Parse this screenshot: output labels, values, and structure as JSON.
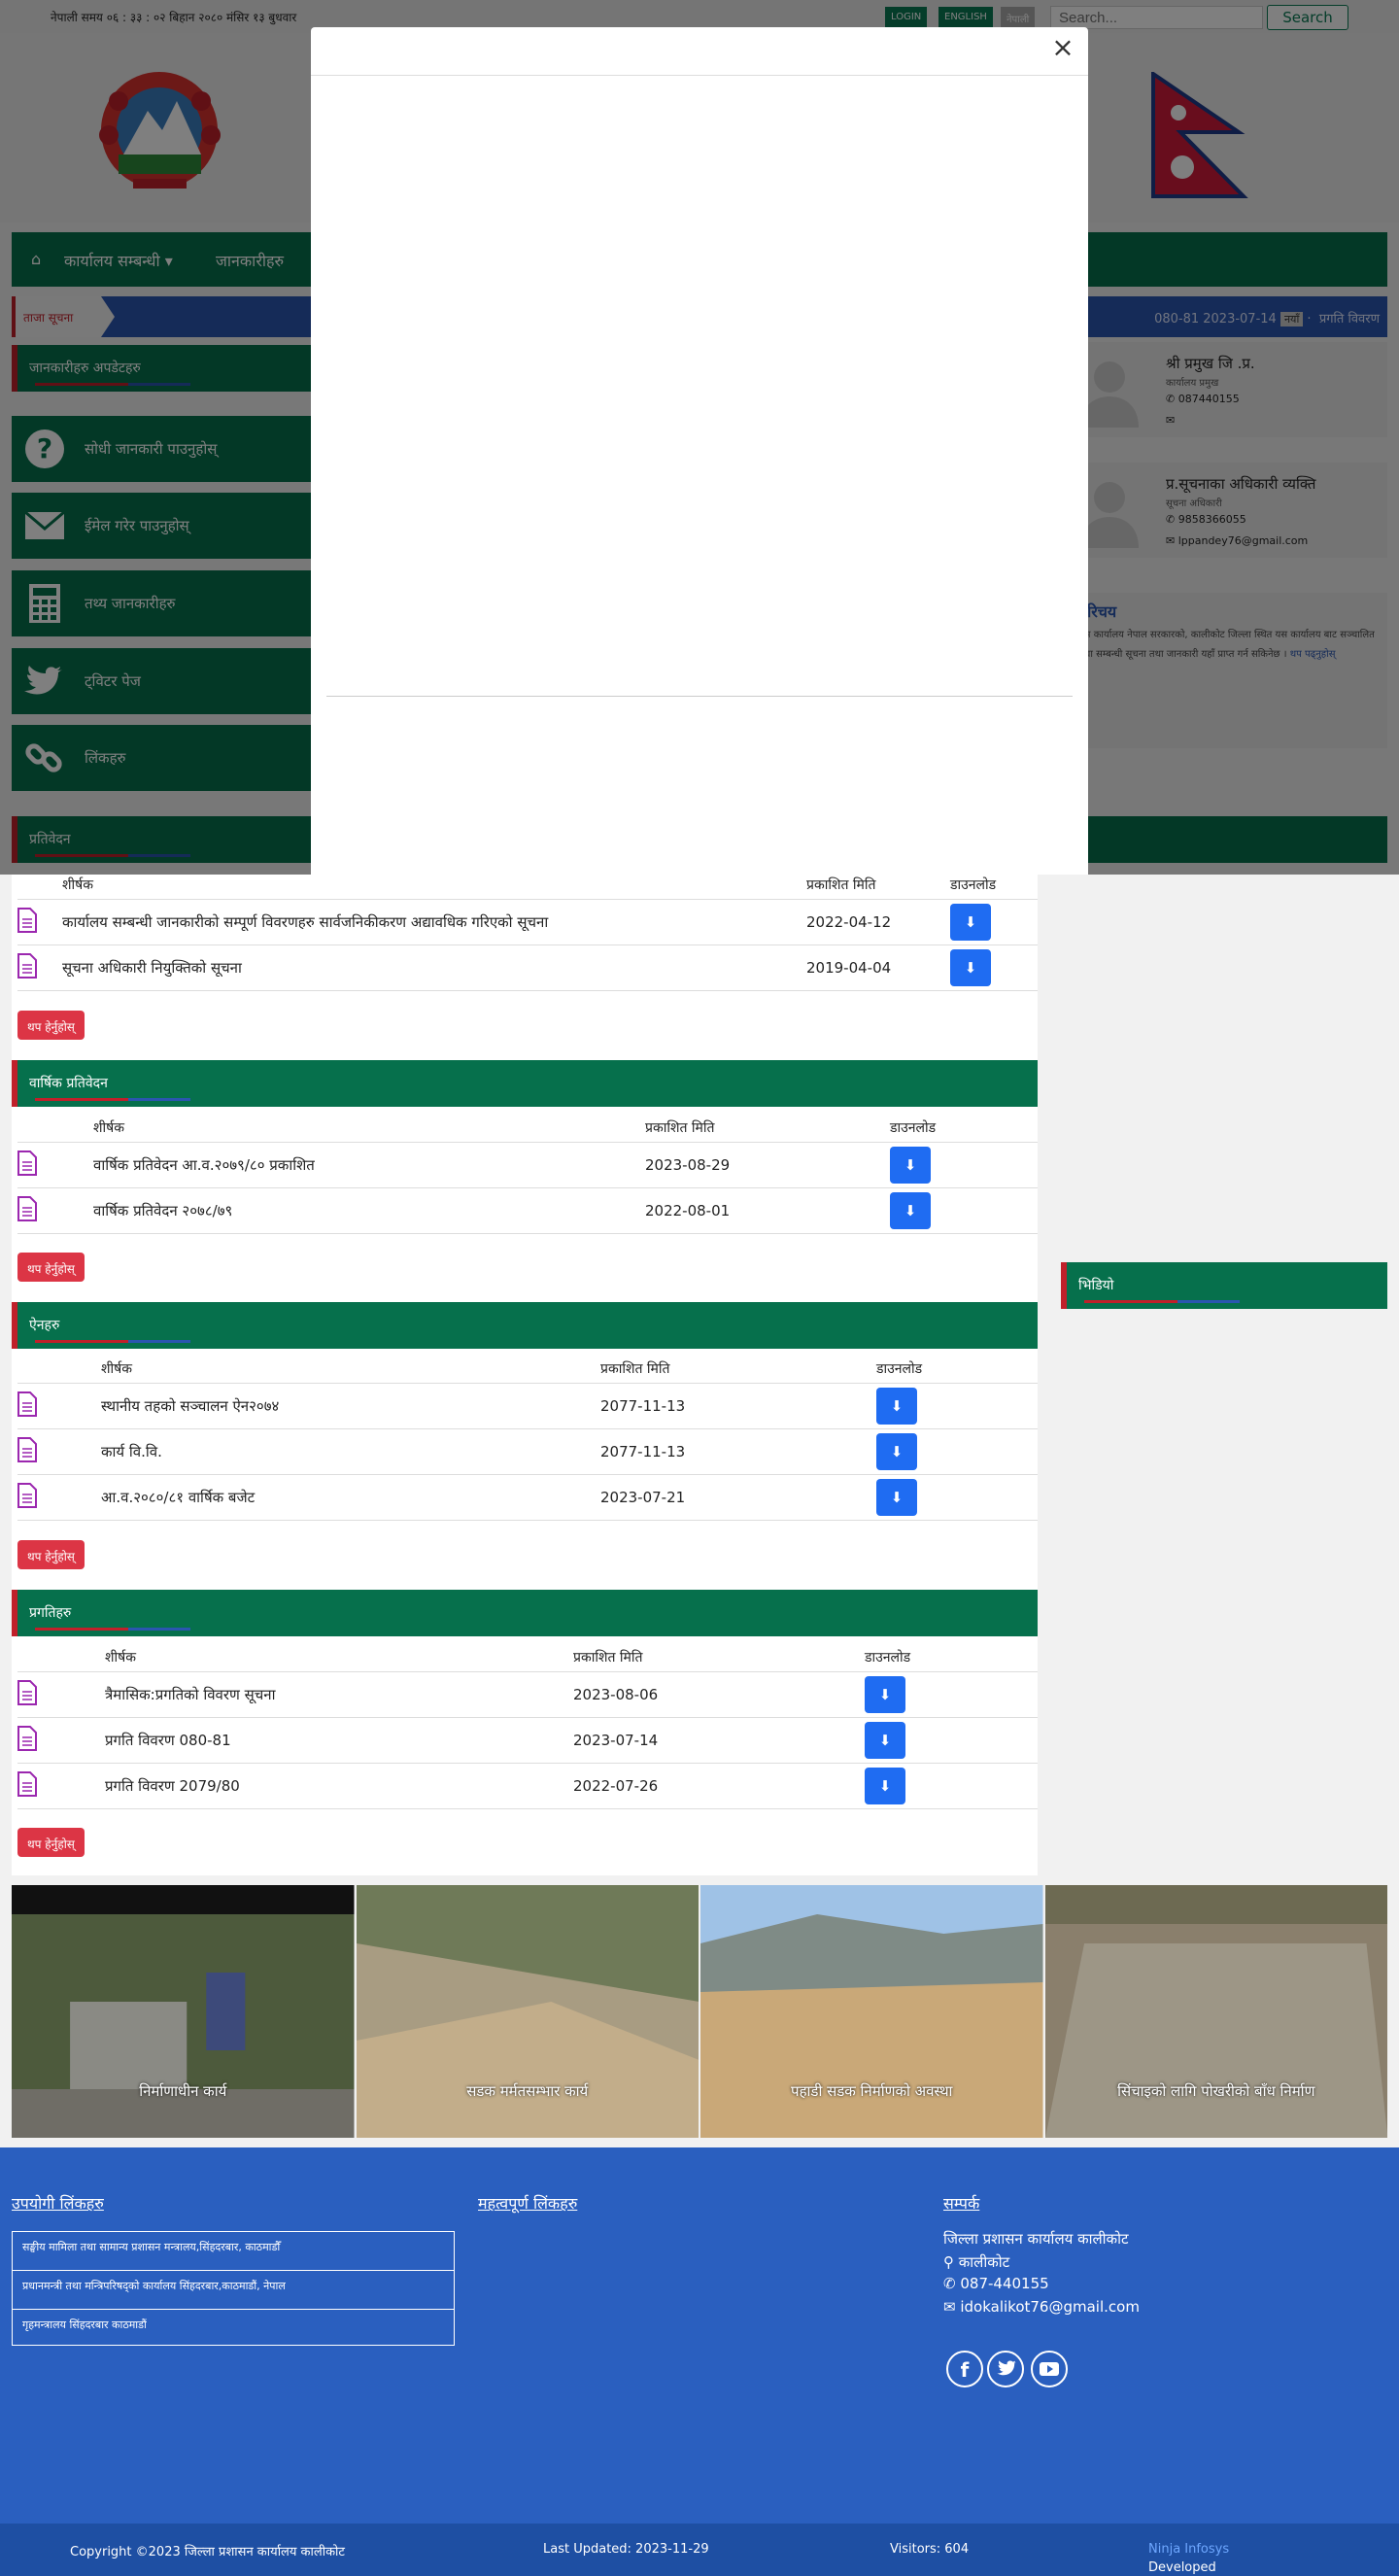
{
  "topbar": {
    "time": "नेपाली समय ०६ : ३३ : ०२ बिहान   २०८० मंसिर १३ बुधवार",
    "login": "LOGIN",
    "english": "ENGLISH",
    "nepali": "नेपाली",
    "search_placeholder": "Search...",
    "search_button": "Search"
  },
  "nav": {
    "home_icon": "home-icon",
    "items": [
      "कार्यालय सम्बन्धी",
      "जानकारीहरु"
    ]
  },
  "ticker": {
    "label": "ताजा सूचना",
    "news": "080-81 2023-07-14",
    "tag": "नयाँ",
    "news2": "प्रगति विवरण"
  },
  "left": {
    "notice_head": "जानकारीहरु अपडेटहरु",
    "buttons": [
      {
        "label": "सोधी जानकारी पाउनुहोस्",
        "icon": "question-icon"
      },
      {
        "label": "ईमेल गरेर पाउनुहोस्",
        "icon": "envelope-icon"
      },
      {
        "label": "तथ्य जानकारीहरु",
        "icon": "calculator-icon"
      },
      {
        "label": "ट्विटर पेज",
        "icon": "twitter-icon"
      },
      {
        "label": "लिंकहरु",
        "icon": "link-icon"
      }
    ],
    "bottom_head": "प्रतिवेदन"
  },
  "officials": [
    {
      "name": "श्री प्रमुख जि .प्र.",
      "role": "कार्यालय प्रमुख",
      "phone": "087440155",
      "email": ""
    },
    {
      "name": "प्र.सूचनाका अधिकारी व्यक्ति",
      "role": "सूचना अधिकारी",
      "phone": "9858366055",
      "email": "lppandey76@gmail.com"
    }
  ],
  "about": {
    "title": "परिचय",
    "text": "यस कार्यालय नेपाल सरकारको, कालीकोट जिल्ला स्थित यस कार्यालय बाट सञ्चालित सेवा सम्बन्धी सूचना तथा जानकारी यहाँ प्राप्त गर्न सकिनेछ ।",
    "more": "थप पढ्नुहोस्"
  },
  "right_head": "भिडियो",
  "sections": [
    {
      "title": "",
      "columns": [
        "शीर्षक",
        "प्रकाशित मिति",
        "डाउनलोड"
      ],
      "rows": [
        {
          "title": "कार्यालय सम्बन्धी जानकारीको सम्पूर्ण विवरणहरु सार्वजनिकीकरण अद्यावधिक गरिएको सूचना",
          "date": "2022-04-12"
        },
        {
          "title": "सूचना अधिकारी नियुक्तिको सूचना",
          "date": "2019-04-04"
        }
      ],
      "more": "थप हेर्नुहोस्"
    },
    {
      "title": "वार्षिक प्रतिवेदन",
      "columns": [
        "शीर्षक",
        "प्रकाशित मिति",
        "डाउनलोड"
      ],
      "rows": [
        {
          "title": "वार्षिक प्रतिवेदन आ.व.२०७९/८० प्रकाशित",
          "date": "2023-08-29"
        },
        {
          "title": "वार्षिक प्रतिवेदन २०७८/७९",
          "date": "2022-08-01"
        }
      ],
      "more": "थप हेर्नुहोस्"
    },
    {
      "title": "ऐनहरु",
      "columns": [
        "शीर्षक",
        "प्रकाशित मिति",
        "डाउनलोड"
      ],
      "rows": [
        {
          "title": "स्थानीय तहको सञ्चालन ऐन२०७४",
          "date": "2077-11-13"
        },
        {
          "title": "कार्य वि.वि.",
          "date": "2077-11-13"
        },
        {
          "title": "आ.व.२०८०/८१ वार्षिक बजेट",
          "date": "2023-07-21"
        }
      ],
      "more": "थप हेर्नुहोस्"
    },
    {
      "title": "प्रगतिहरु",
      "columns": [
        "शीर्षक",
        "प्रकाशित मिति",
        "डाउनलोड"
      ],
      "rows": [
        {
          "title": "त्रैमासिक:प्रगतिको विवरण सूचना",
          "date": "2023-08-06"
        },
        {
          "title": "प्रगति विवरण 080-81",
          "date": "2023-07-14"
        },
        {
          "title": "प्रगति विवरण 2079/80",
          "date": "2022-07-26"
        }
      ],
      "more": "थप हेर्नुहोस्"
    }
  ],
  "gallery": [
    {
      "caption": "निर्माणाधीन कार्य"
    },
    {
      "caption": "सडक मर्मतसम्भार कार्य"
    },
    {
      "caption": "पहाडी सडक निर्माणको अवस्था"
    },
    {
      "caption": "सिंचाइको लागि पोखरीको बाँध निर्माण"
    }
  ],
  "footer": {
    "links_title": "उपयोगी लिंकहरु",
    "links": [
      "सङ्घीय मामिला तथा सामान्य प्रशासन मन्त्रालय,सिंहदरबार, काठमाडौँ",
      "प्रधानमन्त्री तथा मन्त्रिपरिषद्को कार्यालय सिंहदरबार,काठमाडौं, नेपाल",
      "गृहमन्त्रालय सिंहदरबार काठमाडौं"
    ],
    "important_title": "महत्वपूर्ण लिंकहरु",
    "contact_title": "सम्पर्क",
    "office": "जिल्ला प्रशासन कार्यालय कालीकोट",
    "address": "कालीकोट",
    "phone": "087-440155",
    "email": "idokalikot76@gmail.com",
    "social": [
      "facebook-icon",
      "twitter-icon",
      "youtube-icon"
    ]
  },
  "bottom": {
    "copyright": "Copyright ©2023 जिल्ला प्रशासन कार्यालय कालीकोट",
    "updated": "Last Updated: 2023-11-29",
    "visitors": "Visitors: 604",
    "developed": "Developed By:",
    "developer": "Ninja Infosys"
  },
  "colors": {
    "primary_green": "#06704c",
    "accent_red": "#c0202a",
    "footer_blue": "#2a5fbf",
    "download_blue": "#1f6cf2"
  }
}
